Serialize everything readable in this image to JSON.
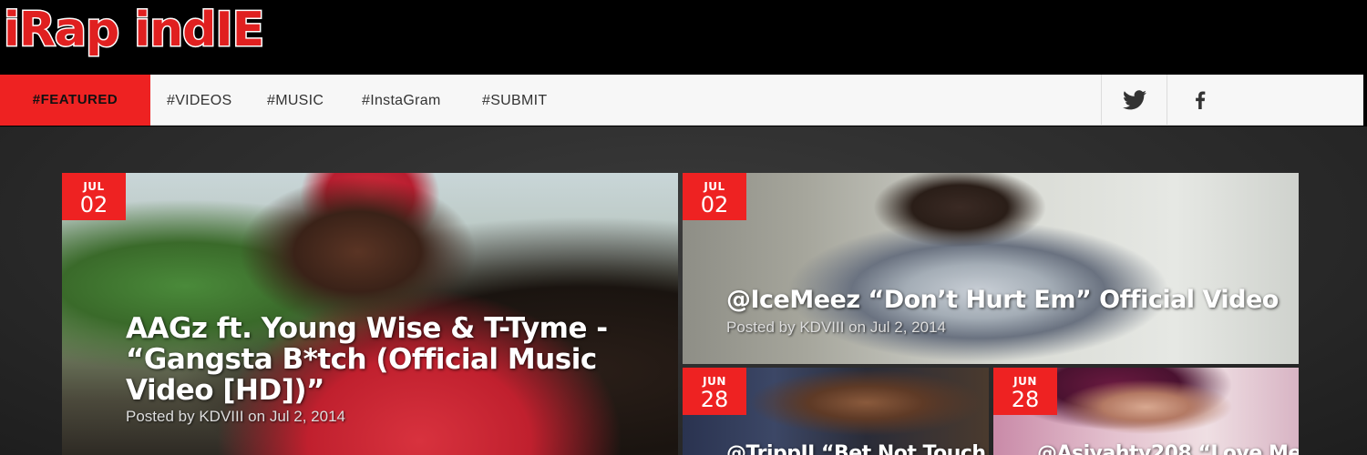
{
  "logo": {
    "part1": "iRap",
    "part2": "indIE"
  },
  "nav": {
    "featured": "#FEATURED",
    "items": [
      "#VIDEOS",
      "#MUSIC",
      "#InstaGram",
      "#SUBMIT"
    ],
    "social": [
      "twitter-icon",
      "facebook-icon"
    ]
  },
  "posts": [
    {
      "month": "JUL",
      "day": "02",
      "title": "AAGz ft. Young Wise & T-Tyme - “Gangsta B*tch (Official Music Video [HD])”",
      "posted_prefix": "Posted by ",
      "author": "KDVIII",
      "date_prefix": " on ",
      "date": "Jul 2, 2014"
    },
    {
      "month": "JUL",
      "day": "02",
      "title": "@IceMeez “Don’t Hurt Em” Official Video",
      "posted_prefix": "Posted by ",
      "author": "KDVIII",
      "date_prefix": " on ",
      "date": "Jul 2, 2014"
    },
    {
      "month": "JUN",
      "day": "28",
      "title": "@TrippII “Bet Not Touch"
    },
    {
      "month": "JUN",
      "day": "28",
      "title": "@Asiyahty208 “Love Me"
    }
  ],
  "colors": {
    "accent": "#ee2222",
    "nav_bg": "#f7f7f7",
    "page_bg": "#2a2a2a"
  }
}
